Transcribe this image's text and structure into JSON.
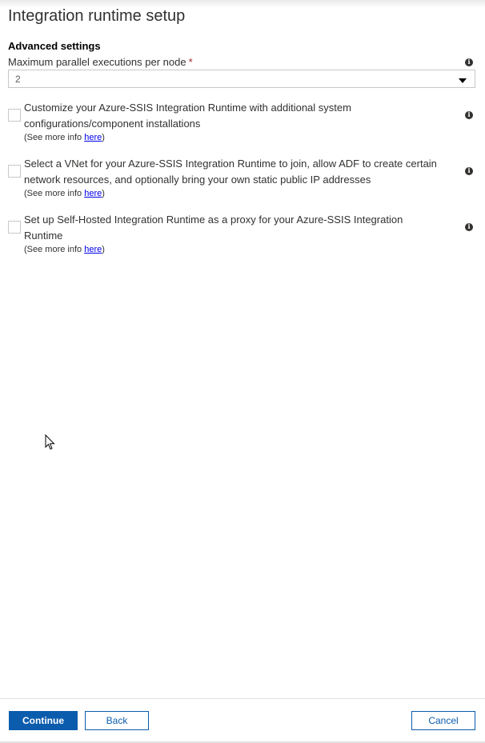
{
  "header": {
    "title": "Integration runtime setup"
  },
  "advanced": {
    "section_title": "Advanced settings",
    "max_parallel_label": "Maximum parallel executions per node",
    "required_mark": "*",
    "max_parallel_value": "2"
  },
  "options": [
    {
      "text": "Customize your Azure-SSIS Integration Runtime with additional system configurations/component installations",
      "see_more_prefix": "(See more info ",
      "see_more_link": "here",
      "see_more_suffix": ")",
      "checked": false
    },
    {
      "text": "Select a VNet for your Azure-SSIS Integration Runtime to join, allow ADF to create certain network resources, and optionally bring your own static public IP addresses",
      "see_more_prefix": "(See more info ",
      "see_more_link": "here",
      "see_more_suffix": ")",
      "checked": false
    },
    {
      "text": "Set up Self-Hosted Integration Runtime as a proxy for your Azure-SSIS Integration Runtime",
      "see_more_prefix": "(See more info ",
      "see_more_link": "here",
      "see_more_suffix": ")",
      "checked": false
    }
  ],
  "footer": {
    "continue_label": "Continue",
    "back_label": "Back",
    "cancel_label": "Cancel"
  },
  "colors": {
    "primary": "#0b5cad",
    "required": "#a4262c",
    "link": "#0000ee"
  }
}
